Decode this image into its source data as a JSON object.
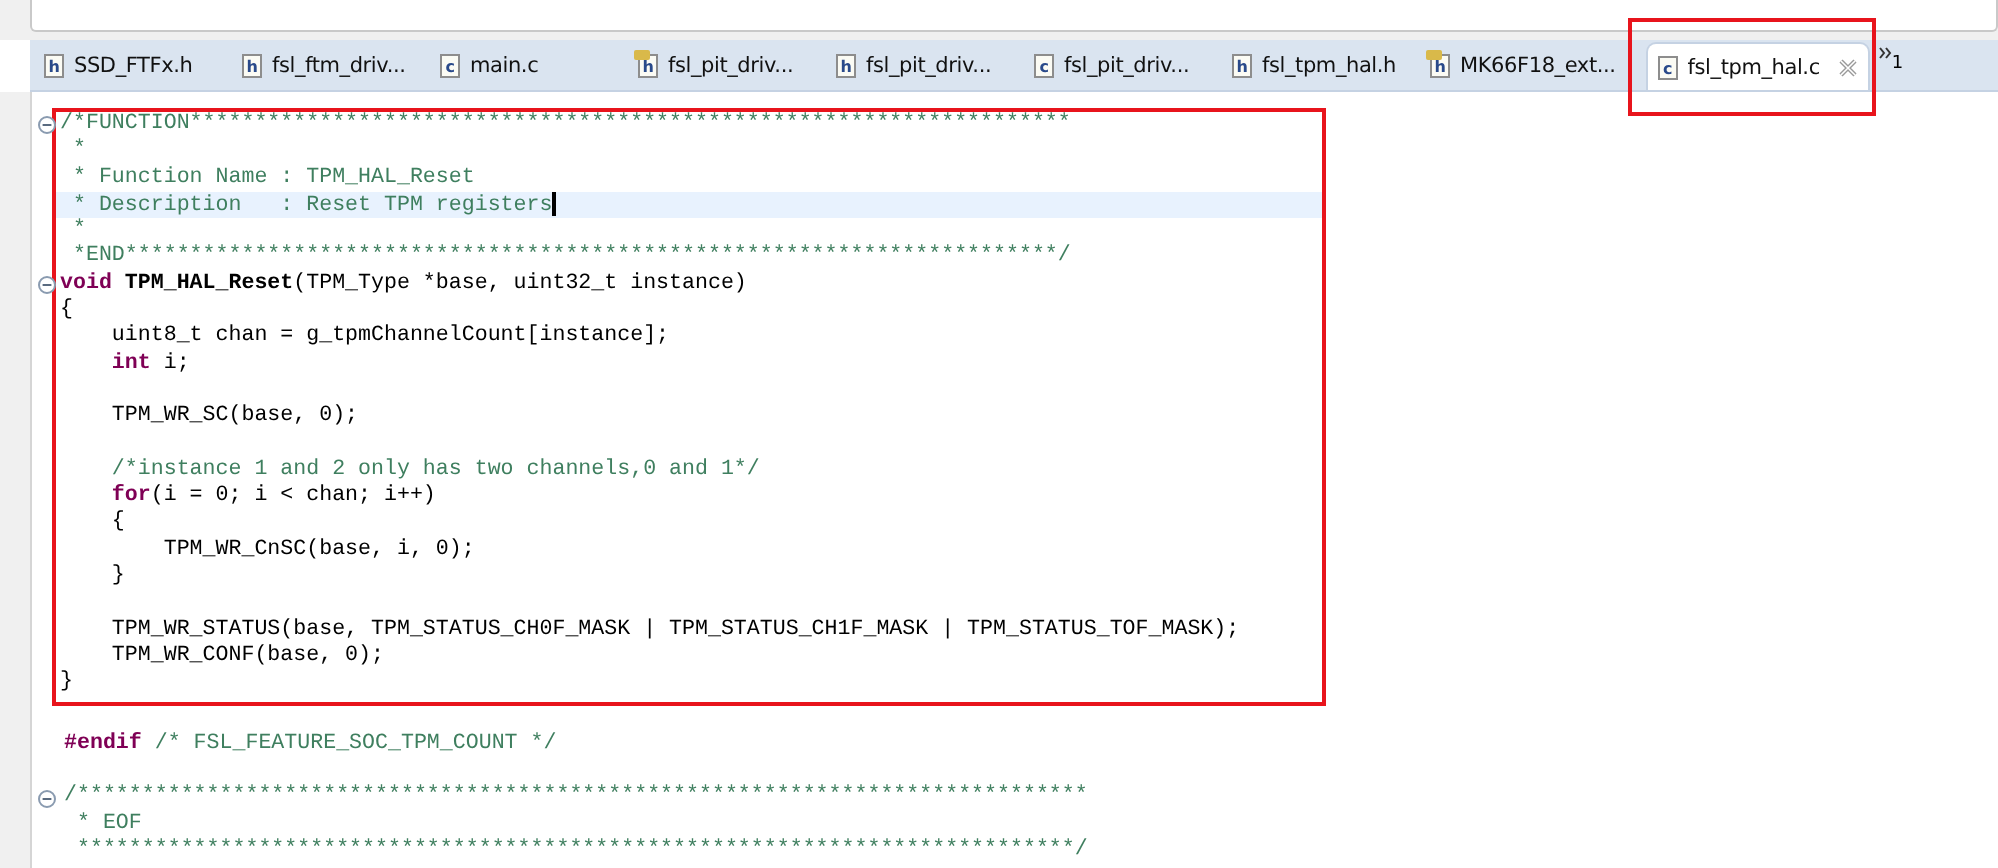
{
  "tabs": [
    {
      "label": "SSD_FTFx.h",
      "icon": "h",
      "decorated": false,
      "selected": false,
      "highlighted": false
    },
    {
      "label": "fsl_ftm_driv...",
      "icon": "h",
      "decorated": false,
      "selected": false,
      "highlighted": false
    },
    {
      "label": "main.c",
      "icon": "c",
      "decorated": false,
      "selected": false,
      "highlighted": false
    },
    {
      "label": "fsl_pit_driv...",
      "icon": "h",
      "decorated": true,
      "selected": false,
      "highlighted": false
    },
    {
      "label": "fsl_pit_driv...",
      "icon": "h",
      "decorated": false,
      "selected": false,
      "highlighted": false
    },
    {
      "label": "fsl_pit_driv...",
      "icon": "c",
      "decorated": false,
      "selected": false,
      "highlighted": false
    },
    {
      "label": "fsl_tpm_hal.h",
      "icon": "h",
      "decorated": false,
      "selected": false,
      "highlighted": false
    },
    {
      "label": "MK66F18_ext...",
      "icon": "h",
      "decorated": true,
      "selected": false,
      "highlighted": false
    },
    {
      "label": "fsl_tpm_hal.c",
      "icon": "c",
      "decorated": false,
      "selected": true,
      "highlighted": true
    }
  ],
  "overflow": {
    "count": "1"
  },
  "framed_block": [
    {
      "fold": true,
      "current": false,
      "tokens": [
        {
          "kind": "comment",
          "text": "/*FUNCTION********************************************************************"
        }
      ]
    },
    {
      "fold": false,
      "current": false,
      "tokens": [
        {
          "kind": "comment",
          "text": " *"
        }
      ]
    },
    {
      "fold": false,
      "current": false,
      "tokens": [
        {
          "kind": "comment",
          "text": " * Function Name : TPM_HAL_Reset"
        }
      ]
    },
    {
      "fold": false,
      "current": true,
      "tokens": [
        {
          "kind": "comment",
          "text": " * Description   : Reset TPM registers"
        }
      ]
    },
    {
      "fold": false,
      "current": false,
      "tokens": [
        {
          "kind": "comment",
          "text": " *"
        }
      ]
    },
    {
      "fold": false,
      "current": false,
      "tokens": [
        {
          "kind": "comment",
          "text": " *END************************************************************************/"
        }
      ]
    },
    {
      "fold": true,
      "current": false,
      "tokens": [
        {
          "kind": "keyword",
          "text": "void"
        },
        {
          "kind": "function",
          "text": " TPM_HAL_Reset"
        },
        {
          "kind": "plain",
          "text": "(TPM_Type *base, uint32_t instance)"
        }
      ]
    },
    {
      "fold": false,
      "current": false,
      "tokens": [
        {
          "kind": "plain",
          "text": "{"
        }
      ]
    },
    {
      "fold": false,
      "current": false,
      "tokens": [
        {
          "kind": "plain",
          "text": "    uint8_t chan = g_tpmChannelCount[instance];"
        }
      ]
    },
    {
      "fold": false,
      "current": false,
      "tokens": [
        {
          "kind": "keyword",
          "text": "    int"
        },
        {
          "kind": "plain",
          "text": " i;"
        }
      ]
    },
    {
      "fold": false,
      "current": false
    },
    {
      "fold": false,
      "current": false,
      "tokens": [
        {
          "kind": "plain",
          "text": "    TPM_WR_SC(base, 0);"
        }
      ]
    },
    {
      "fold": false,
      "current": false
    },
    {
      "fold": false,
      "current": false,
      "tokens": [
        {
          "kind": "comment",
          "text": "    /*instance 1 and 2 only has two channels,0 and 1*/"
        }
      ]
    },
    {
      "fold": false,
      "current": false,
      "tokens": [
        {
          "kind": "keyword",
          "text": "    for"
        },
        {
          "kind": "plain",
          "text": "(i = 0; i < chan; i++)"
        }
      ]
    },
    {
      "fold": false,
      "current": false,
      "tokens": [
        {
          "kind": "plain",
          "text": "    {"
        }
      ]
    },
    {
      "fold": false,
      "current": false,
      "tokens": [
        {
          "kind": "plain",
          "text": "        TPM_WR_CnSC(base, i, 0);"
        }
      ]
    },
    {
      "fold": false,
      "current": false,
      "tokens": [
        {
          "kind": "plain",
          "text": "    }"
        }
      ]
    },
    {
      "fold": false,
      "current": false
    },
    {
      "fold": false,
      "current": false,
      "tokens": [
        {
          "kind": "plain",
          "text": "    TPM_WR_STATUS(base, TPM_STATUS_CH0F_MASK | TPM_STATUS_CH1F_MASK | TPM_STATUS_TOF_MASK);"
        }
      ]
    },
    {
      "fold": false,
      "current": false,
      "tokens": [
        {
          "kind": "plain",
          "text": "    TPM_WR_CONF(base, 0);"
        }
      ]
    },
    {
      "fold": false,
      "current": false,
      "tokens": [
        {
          "kind": "plain",
          "text": "}"
        }
      ]
    }
  ],
  "after_lines": [
    {
      "fold": false,
      "current": false
    },
    {
      "fold": false,
      "current": false,
      "tokens": [
        {
          "kind": "keyword",
          "text": "#endif"
        },
        {
          "kind": "comment",
          "text": " /* FSL_FEATURE_SOC_TPM_COUNT */"
        }
      ]
    },
    {
      "fold": false,
      "current": false
    },
    {
      "fold": true,
      "current": false,
      "tokens": [
        {
          "kind": "comment",
          "text": "/******************************************************************************"
        }
      ]
    },
    {
      "fold": false,
      "current": false,
      "tokens": [
        {
          "kind": "comment",
          "text": " * EOF"
        }
      ]
    },
    {
      "fold": false,
      "current": false,
      "tokens": [
        {
          "kind": "comment",
          "text": " *****************************************************************************/"
        }
      ]
    }
  ]
}
